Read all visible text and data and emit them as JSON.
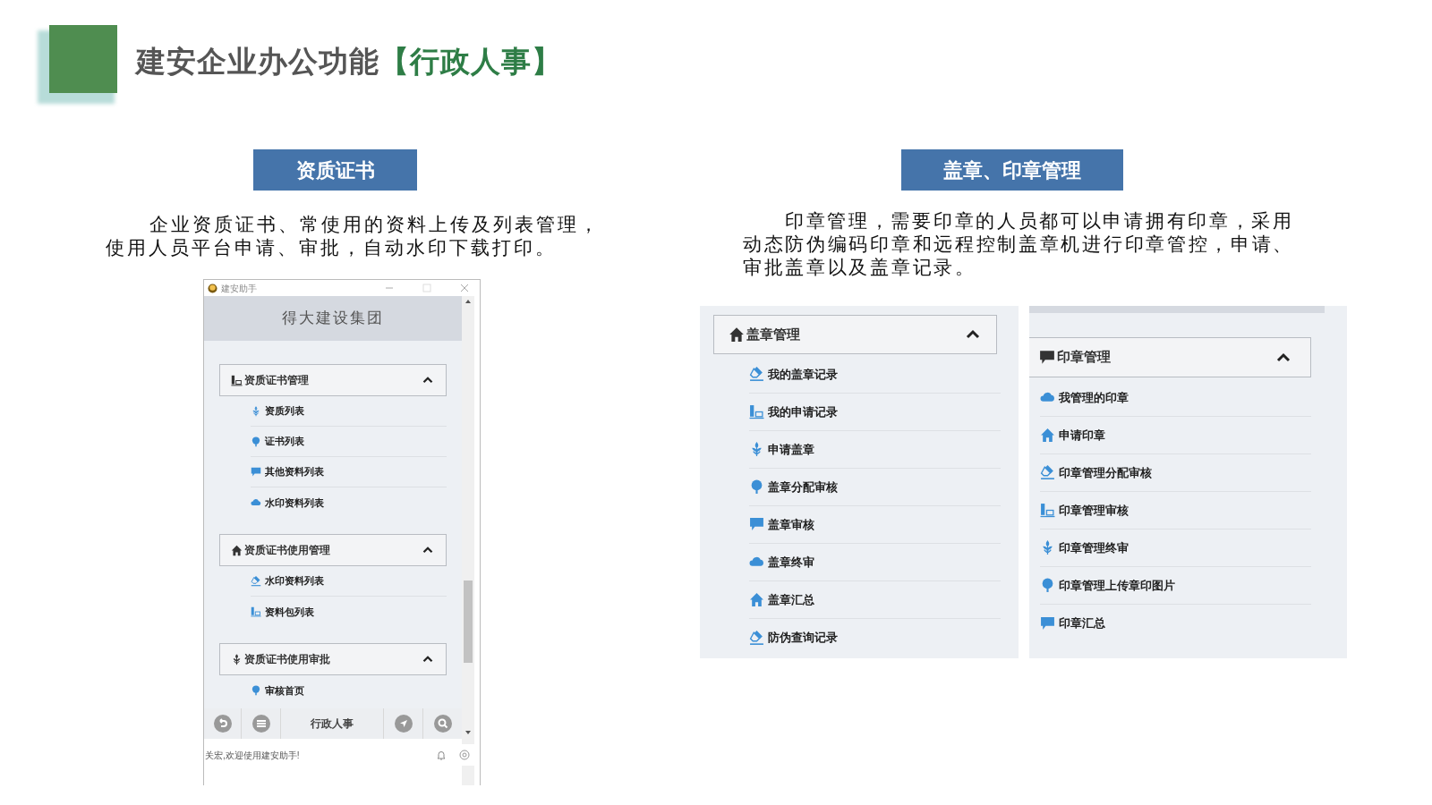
{
  "title": {
    "main": "建安企业办公功能",
    "tag": "【行政人事】"
  },
  "sections": [
    {
      "label": "资质证书",
      "description": "企业资质证书、常使用的资料上传及列表管理，使用人员平台申请、审批，自动水印下载打印。"
    },
    {
      "label": "盖章、印章管理",
      "description": "印章管理，需要印章的人员都可以申请拥有印章，采用动态防伪编码印章和远程控制盖章机进行印章管控，申请、审批盖章以及盖章记录。"
    }
  ],
  "app_window": {
    "title": "建安助手",
    "header": "得大建设集团",
    "groups": [
      {
        "label": "资质证书管理",
        "kind": "chart",
        "expanded": true,
        "items": [
          {
            "label": "资质列表",
            "kind": "sprout"
          },
          {
            "label": "证书列表",
            "kind": "tree"
          },
          {
            "label": "其他资料列表",
            "kind": "chat"
          },
          {
            "label": "水印资料列表",
            "kind": "cloud"
          }
        ]
      },
      {
        "label": "资质证书使用管理",
        "kind": "home",
        "expanded": true,
        "items": [
          {
            "label": "水印资料列表",
            "kind": "eraser"
          },
          {
            "label": "资料包列表",
            "kind": "chart"
          }
        ]
      },
      {
        "label": "资质证书使用审批",
        "kind": "sprout",
        "expanded": true,
        "items": [
          {
            "label": "审核首页",
            "kind": "tree"
          }
        ]
      }
    ],
    "toolbar_label": "行政人事",
    "status": "关宏,欢迎使用建安助手!"
  },
  "seal_panels": [
    {
      "label": "盖章管理",
      "kind": "home",
      "expanded": true,
      "items": [
        {
          "label": "我的盖章记录",
          "kind": "eraser"
        },
        {
          "label": "我的申请记录",
          "kind": "chart"
        },
        {
          "label": "申请盖章",
          "kind": "sprout"
        },
        {
          "label": "盖章分配审核",
          "kind": "tree"
        },
        {
          "label": "盖章审核",
          "kind": "chat"
        },
        {
          "label": "盖章终审",
          "kind": "cloud"
        },
        {
          "label": "盖章汇总",
          "kind": "home"
        },
        {
          "label": "防伪查询记录",
          "kind": "eraser"
        }
      ]
    },
    {
      "label": "印章管理",
      "kind": "chat",
      "expanded": true,
      "items": [
        {
          "label": "我管理的印章",
          "kind": "cloud"
        },
        {
          "label": "申请印章",
          "kind": "home"
        },
        {
          "label": "印章管理分配审核",
          "kind": "eraser"
        },
        {
          "label": "印章管理审核",
          "kind": "chart"
        },
        {
          "label": "印章管理终审",
          "kind": "sprout"
        },
        {
          "label": "印章管理上传章印图片",
          "kind": "tree"
        },
        {
          "label": "印章汇总",
          "kind": "chat"
        }
      ]
    }
  ]
}
